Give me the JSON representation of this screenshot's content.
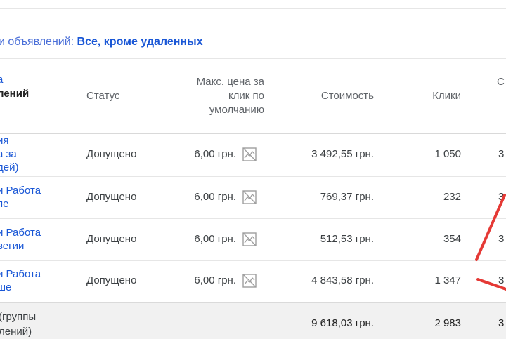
{
  "filter": {
    "label": "и объявлений: ",
    "value": "Все, кроме удаленных"
  },
  "table": {
    "headers": {
      "name_line1": "а",
      "name_line2": "лений",
      "status": "Статус",
      "bid_line1": "Макс. цена за",
      "bid_line2": "клик по",
      "bid_line3": "умолчанию",
      "cost": "Стоимость",
      "clicks": "Клики",
      "ctr": "С"
    },
    "rows": [
      {
        "name1": "ия",
        "name2": "а за",
        "name3": "дей)",
        "status": "Допущено",
        "bid": "6,00 грн.",
        "cost": "3 492,55 грн.",
        "clicks": "1 050",
        "ctr": "3"
      },
      {
        "name1": "и Работа",
        "name2": "пе",
        "name3": "",
        "status": "Допущено",
        "bid": "6,00 грн.",
        "cost": "769,37 грн.",
        "clicks": "232",
        "ctr": "3"
      },
      {
        "name1": "и Работа",
        "name2": "вегии",
        "name3": "",
        "status": "Допущено",
        "bid": "6,00 грн.",
        "cost": "512,53 грн.",
        "clicks": "354",
        "ctr": "3"
      },
      {
        "name1": "и Работа",
        "name2": "ше",
        "name3": "",
        "status": "Допущено",
        "bid": "6,00 грн.",
        "cost": "4 843,58 грн.",
        "clicks": "1 347",
        "ctr": "3"
      }
    ],
    "total": {
      "name1": "(группы",
      "name2": "лений)",
      "cost": "9 618,03 грн.",
      "clicks": "2 983",
      "ctr": "3"
    }
  },
  "icons": {
    "bid_icon": "bid-simulator-unavailable-icon"
  },
  "colors": {
    "link": "#1a57d6",
    "annotation": "#e53935",
    "total_bg": "#f1f1f1"
  }
}
